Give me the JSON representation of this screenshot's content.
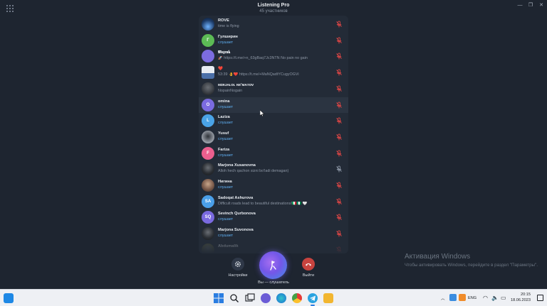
{
  "window": {
    "title": "Listening Pro",
    "subtitle": "45 участников",
    "minimize_glyph": "—",
    "maximize_glyph": "❐",
    "close_glyph": "✕"
  },
  "participants": [
    {
      "name": "ROVE",
      "status": "time is flying",
      "listening": false,
      "avatar_letters": "",
      "avatar_color": "#1c3a66",
      "avatar_kind": "photo-blue"
    },
    {
      "name": "Гулширин",
      "status": "слушает",
      "listening": true,
      "avatar_letters": "Г",
      "avatar_color": "#5cbb55",
      "avatar_kind": "letter"
    },
    {
      "name": "𝕸𝖊𝖟𝖗𝖚𝖐",
      "status": "🚀 https://t.me/+n_63gBaq7Jc3NTN No pain no gain",
      "listening": false,
      "avatar_letters": "",
      "avatar_color": "#7c6ce0",
      "avatar_kind": "letter"
    },
    {
      "name": "❤️",
      "status": "53:39 👌❤️ https://t.me/+MaNQadtYCugyOGVi",
      "listening": false,
      "avatar_letters": "",
      "avatar_color": "#4a6fa8",
      "avatar_kind": "photo-card"
    },
    {
      "name": "ᴍɪʀᴊᴀʟᴏʟ ɴᴇ'ᴍᴀᴛᴏᴠ",
      "status": "NopainNogain",
      "listening": false,
      "avatar_letters": "",
      "avatar_color": "#3b3f45",
      "avatar_kind": "photo-dark"
    },
    {
      "name": "omina",
      "status": "слушает",
      "listening": true,
      "avatar_letters": "O",
      "avatar_color": "#7b6be0",
      "avatar_kind": "letter"
    },
    {
      "name": "Laziza",
      "status": "слушает",
      "listening": true,
      "avatar_letters": "L",
      "avatar_color": "#4aa3e6",
      "avatar_kind": "letter"
    },
    {
      "name": "Yusuf",
      "status": "слушает",
      "listening": true,
      "avatar_letters": "",
      "avatar_color": "#9ea4ad",
      "avatar_kind": "photo-gray"
    },
    {
      "name": "Fariza",
      "status": "слушает",
      "listening": true,
      "avatar_letters": "F",
      "avatar_color": "#ec5f8e",
      "avatar_kind": "letter"
    },
    {
      "name": "Marjona Xusanovna",
      "status": "Alloh hech qachon sizni bo'ladi demagan)",
      "listening": false,
      "avatar_letters": "",
      "avatar_color": "#2a2e33",
      "avatar_kind": "photo-dark"
    },
    {
      "name": "Нигина",
      "status": "слушает",
      "listening": true,
      "avatar_letters": "",
      "avatar_color": "#7a5a4a",
      "avatar_kind": "photo-warm"
    },
    {
      "name": "Sadoqat Ashurova",
      "status": "Difficult roads lead to beautiful destinations!🇮🇹🇳🇬 🤍",
      "listening": false,
      "avatar_letters": "SA",
      "avatar_color": "#4a9fe8",
      "avatar_kind": "letter"
    },
    {
      "name": "Sevinch Qurbonova",
      "status": "слушает",
      "listening": true,
      "avatar_letters": "SQ",
      "avatar_color": "#7a6ae0",
      "avatar_kind": "letter"
    },
    {
      "name": "Marjona Suvonova",
      "status": "слушает",
      "listening": true,
      "avatar_letters": "",
      "avatar_color": "#2c3036",
      "avatar_kind": "photo-dark"
    },
    {
      "name": "Abdumalik",
      "status": "",
      "listening": false,
      "avatar_letters": "",
      "avatar_color": "#5a5a3a",
      "avatar_kind": "photo-dark"
    }
  ],
  "controls": {
    "settings_label": "Настройки",
    "leave_label": "Выйти",
    "status_label": "Вы — слушатель"
  },
  "watermark": {
    "title": "Активация Windows",
    "text": "Чтобы активировать Windows, перейдите в раздел \"Параметры\"."
  },
  "taskbar": {
    "language": "ENG",
    "time": "20:15",
    "date": "18.06.2023"
  },
  "colors": {
    "background": "#1e2530",
    "panel": "#232b37",
    "accent_listening": "#5eaef0",
    "leave_red": "#c8433f",
    "mic_muted_red": "#d64545"
  }
}
